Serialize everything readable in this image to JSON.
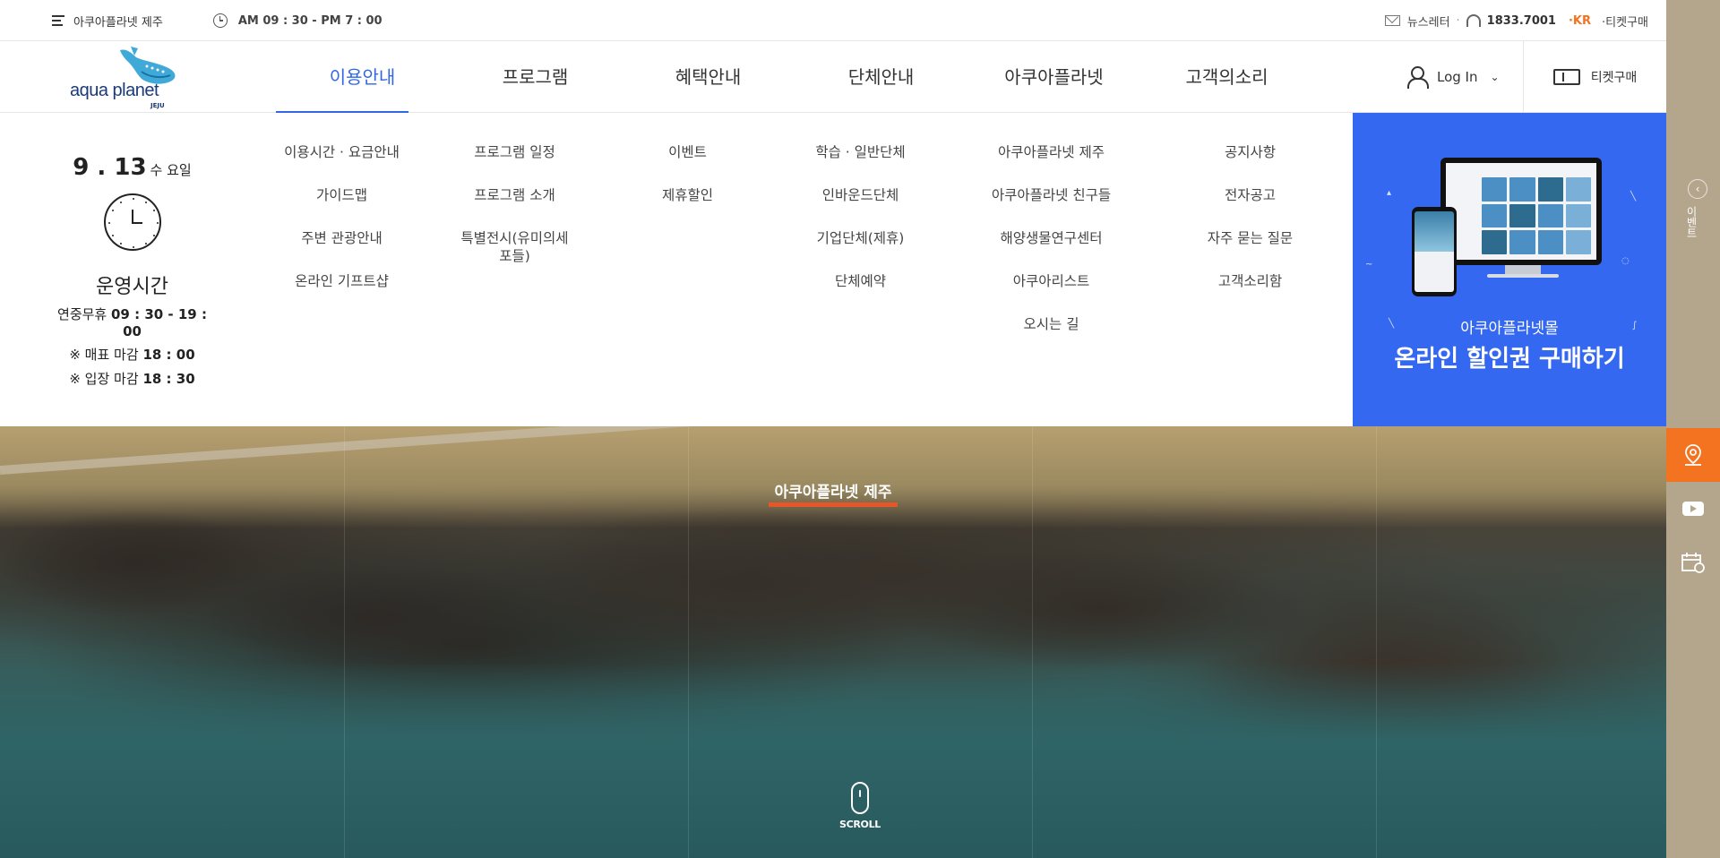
{
  "util_bar": {
    "site_menu": "아쿠아플라넷 제주",
    "hours": "AM 09 : 30 - PM 7 : 00",
    "newsletter": "뉴스레터",
    "phone": "1833.7001",
    "lang": "·KR",
    "ticket": "·티켓구매"
  },
  "logo": {
    "text": "aqua planet",
    "sub": "JEJU"
  },
  "nav": {
    "items": [
      {
        "label": "이용안내"
      },
      {
        "label": "프로그램"
      },
      {
        "label": "혜택안내"
      },
      {
        "label": "단체안내"
      },
      {
        "label": "아쿠아플라넷"
      },
      {
        "label": "고객의소리"
      }
    ],
    "login": "Log In",
    "ticket": "티켓구매"
  },
  "hours_box": {
    "date": "9 . 13",
    "dow": "수 요일",
    "title": "운영시간",
    "line1_label": "연중무휴",
    "line1_value": "09 : 30 - 19 : 00",
    "line2_label": "※ 매표 마감",
    "line2_value": "18 : 00",
    "line3_label": "※ 입장 마감",
    "line3_value": "18 : 30"
  },
  "mega_menu": {
    "col1": [
      "이용시간 · 요금안내",
      "가이드맵",
      "주변 관광안내",
      "온라인 기프트샵"
    ],
    "col2": [
      "프로그램 일정",
      "프로그램 소개",
      "특별전시(유미의세포들)"
    ],
    "col3": [
      "이벤트",
      "제휴할인"
    ],
    "col4": [
      "학습 · 일반단체",
      "인바운드단체",
      "기업단체(제휴)",
      "단체예약"
    ],
    "col5": [
      "아쿠아플라넷 제주",
      "아쿠아플라넷 친구들",
      "해양생물연구센터",
      "아쿠아리스트",
      "오시는 길"
    ],
    "col6": [
      "공지사항",
      "전자공고",
      "자주 묻는 질문",
      "고객소리함"
    ]
  },
  "promo": {
    "small": "아쿠아플라넷몰",
    "big": "온라인 할인권 구매하기",
    "color": "#3568f0"
  },
  "hero": {
    "subtitle": "아쿠아플라넷 제주",
    "scroll": "SCROLL"
  },
  "side_tab": {
    "label": "이벤트"
  },
  "colors": {
    "accent": "#3366e6",
    "orange": "#f37321"
  }
}
